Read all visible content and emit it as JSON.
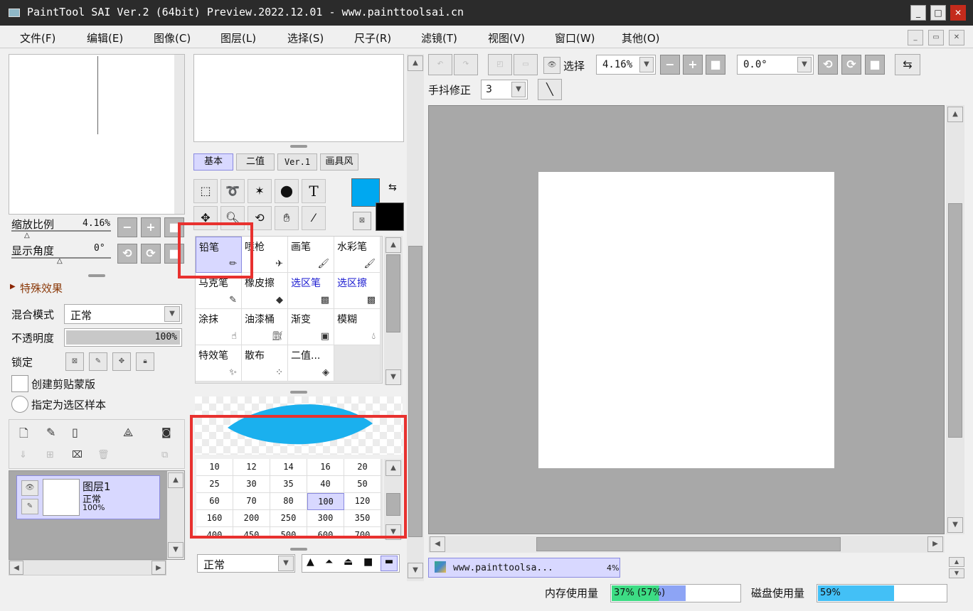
{
  "window": {
    "title": "PaintTool SAI Ver.2 (64bit) Preview.2022.12.01 - www.painttoolsai.cn",
    "min": "_",
    "max": "□",
    "close": "✕"
  },
  "menu": [
    "文件(F)",
    "编辑(E)",
    "图像(C)",
    "图层(L)",
    "选择(S)",
    "尺子(R)",
    "滤镜(T)",
    "视图(V)",
    "窗口(W)",
    "其他(O)"
  ],
  "nav": {
    "zoom_label": "缩放比例",
    "zoom_value": "4.16%",
    "angle_label": "显示角度",
    "angle_value": "0°"
  },
  "layerprops": {
    "effects": "特殊效果",
    "blend_label": "混合模式",
    "blend_value": "正常",
    "opacity_label": "不透明度",
    "opacity_value": "100%",
    "opacity_pct": 100,
    "lock_label": "锁定",
    "clip": "创建剪贴蒙版",
    "sample": "指定为选区样本"
  },
  "layer": {
    "name": "图层1",
    "mode": "正常",
    "opacity": "100%"
  },
  "tabs": [
    "基本",
    "二值",
    "Ver.1",
    "画具风"
  ],
  "colors": {
    "fg": "#00a8f0",
    "bg": "#000000",
    "accent": "#d8d8ff",
    "red": "#e8312f"
  },
  "brushes": [
    [
      "铅笔",
      "喷枪",
      "画笔",
      "水彩笔"
    ],
    [
      "马克笔",
      "橡皮擦",
      "选区笔",
      "选区擦"
    ],
    [
      "涂抹",
      "油漆桶",
      "渐变",
      "模糊"
    ],
    [
      "特效笔",
      "散布",
      "二值...",
      ""
    ]
  ],
  "sizes": [
    [
      "10",
      "12",
      "14",
      "16",
      "20"
    ],
    [
      "25",
      "30",
      "35",
      "40",
      "50"
    ],
    [
      "60",
      "70",
      "80",
      "100",
      "120"
    ],
    [
      "160",
      "200",
      "250",
      "300",
      "350"
    ],
    [
      "400",
      "450",
      "500",
      "600",
      "700"
    ]
  ],
  "brush_mode": "正常",
  "toolbar": {
    "select_label": "选择",
    "zoom": "4.16%",
    "angle": "0.0°",
    "stabilizer_label": "手抖修正",
    "stabilizer": "3"
  },
  "nav_item": {
    "name": "www.painttoolsa...",
    "pct": "4%"
  },
  "status": {
    "mem_label": "内存使用量",
    "mem_value": "37% (57%)",
    "mem_pct": 57,
    "disk_label": "磁盘使用量",
    "disk_value": "59%",
    "disk_pct": 59
  }
}
